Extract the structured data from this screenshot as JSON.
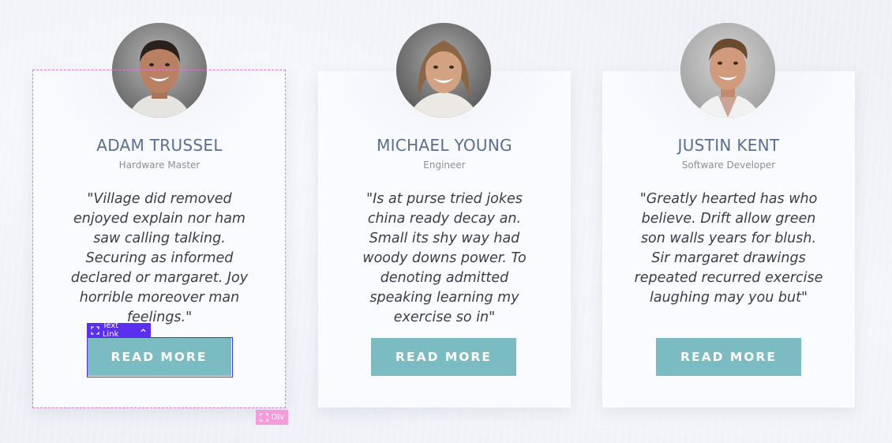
{
  "cards": [
    {
      "name": "ADAM TRUSSEL",
      "role": "Hardware Master",
      "quote": "\"Village did removed enjoyed explain nor ham saw calling talking. Securing as informed declared or margaret. Joy horrible moreover man feelings.\"",
      "button": "READ MORE"
    },
    {
      "name": "MICHAEL YOUNG",
      "role": "Engineer",
      "quote": "\"Is at purse tried jokes china ready decay an. Small its shy way had woody downs power. To denoting admitted speaking learning my exercise so in\"",
      "button": "READ MORE"
    },
    {
      "name": "JUSTIN KENT",
      "role": "Software Developer",
      "quote": "\"Greatly hearted has who believe. Drift allow green son walls years for blush. Sir margaret drawings repeated recurred exercise laughing may you but\"",
      "button": "READ MORE"
    }
  ],
  "editor": {
    "link_badge": "Text Link",
    "div_badge": "Div"
  },
  "colors": {
    "name": "#5a6f8e",
    "button": "#7bbcc2",
    "selection_link": "#5a2ff0",
    "selection_div": "#f59bdc"
  },
  "icons": {
    "badge": "expand-icon",
    "chevron": "chevron-up-icon"
  }
}
